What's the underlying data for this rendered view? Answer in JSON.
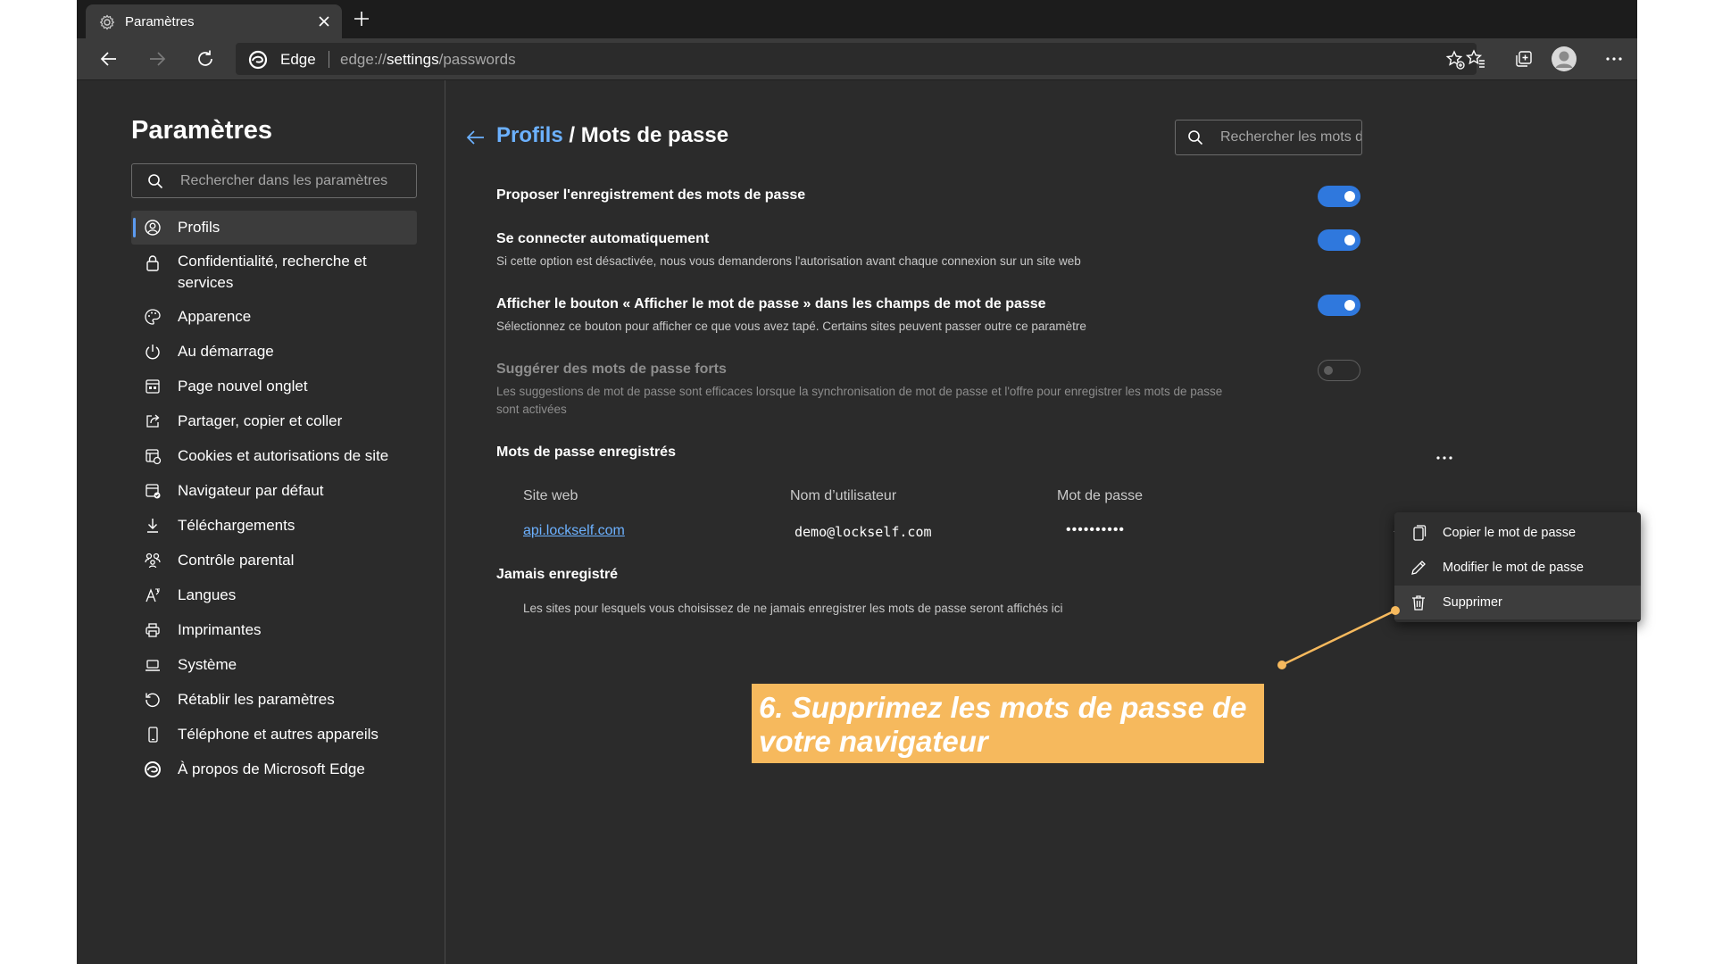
{
  "browser": {
    "tab_title": "Paramètres",
    "address_label": "Edge",
    "url_prefix": "edge://",
    "url_bold": "settings",
    "url_suffix": "/passwords"
  },
  "sidebar": {
    "title": "Paramètres",
    "search_placeholder": "Rechercher dans les paramètres",
    "items": [
      {
        "label": "Profils",
        "icon": "profile-icon",
        "active": true
      },
      {
        "label": "Confidentialité, recherche et",
        "label2": "services",
        "icon": "lock-icon"
      },
      {
        "label": "Apparence",
        "icon": "palette-icon"
      },
      {
        "label": "Au démarrage",
        "icon": "power-icon"
      },
      {
        "label": "Page nouvel onglet",
        "icon": "newtab-page-icon"
      },
      {
        "label": "Partager, copier et coller",
        "icon": "share-icon"
      },
      {
        "label": "Cookies et autorisations de site",
        "icon": "cookies-icon"
      },
      {
        "label": "Navigateur par défaut",
        "icon": "default-browser-icon"
      },
      {
        "label": "Téléchargements",
        "icon": "download-icon"
      },
      {
        "label": "Contrôle parental",
        "icon": "family-icon"
      },
      {
        "label": "Langues",
        "icon": "languages-icon"
      },
      {
        "label": "Imprimantes",
        "icon": "printer-icon"
      },
      {
        "label": "Système",
        "icon": "laptop-icon"
      },
      {
        "label": "Rétablir les paramètres",
        "icon": "reset-icon"
      },
      {
        "label": "Téléphone et autres appareils",
        "icon": "phone-icon"
      },
      {
        "label": "À propos de Microsoft Edge",
        "icon": "edge-logo-icon"
      }
    ]
  },
  "main": {
    "breadcrumb_link": "Profils",
    "breadcrumb_current": " / Mots de passe",
    "search_placeholder": "Rechercher les mots d",
    "settings": [
      {
        "title": "Proposer l'enregistrement des mots de passe",
        "desc": "",
        "enabled": true
      },
      {
        "title": "Se connecter automatiquement",
        "desc": "Si cette option est désactivée, nous vous demanderons l'autorisation avant chaque connexion sur un site web",
        "enabled": true
      },
      {
        "title": "Afficher le bouton « Afficher le mot de passe » dans les champs de mot de passe",
        "desc": "Sélectionnez ce bouton pour afficher ce que vous avez tapé. Certains sites peuvent passer outre ce paramètre",
        "enabled": true
      },
      {
        "title": "Suggérer des mots de passe forts",
        "desc": "Les suggestions de mot de passe sont efficaces lorsque la synchronisation de mot de passe et l'offre pour enregistrer les mots de passe",
        "desc2": "sont activées",
        "enabled": false
      }
    ],
    "saved_title": "Mots de passe enregistrés",
    "columns": [
      "Site web",
      "Nom d’utilisateur",
      "Mot de passe"
    ],
    "rows": [
      {
        "site": "api.lockself.com",
        "user": "demo@lockself.com",
        "password": "••••••••••"
      }
    ],
    "never_title": "Jamais enregistré",
    "never_desc": "Les sites pour lesquels vous choisissez de ne jamais enregistrer les mots de passe seront affichés ici"
  },
  "context_menu": {
    "items": [
      {
        "label": "Copier le mot de passe",
        "icon": "copy-icon"
      },
      {
        "label": "Modifier le mot de passe",
        "icon": "pencil-icon"
      },
      {
        "label": "Supprimer",
        "icon": "trash-icon",
        "highlighted": true
      }
    ]
  },
  "callout": {
    "text": "6. Supprimez les mots de passe de votre navigateur"
  },
  "colors": {
    "accent": "#2f78dd",
    "link": "#6cb1ff",
    "callout": "#f6b95d",
    "background": "#2b2b2b"
  }
}
